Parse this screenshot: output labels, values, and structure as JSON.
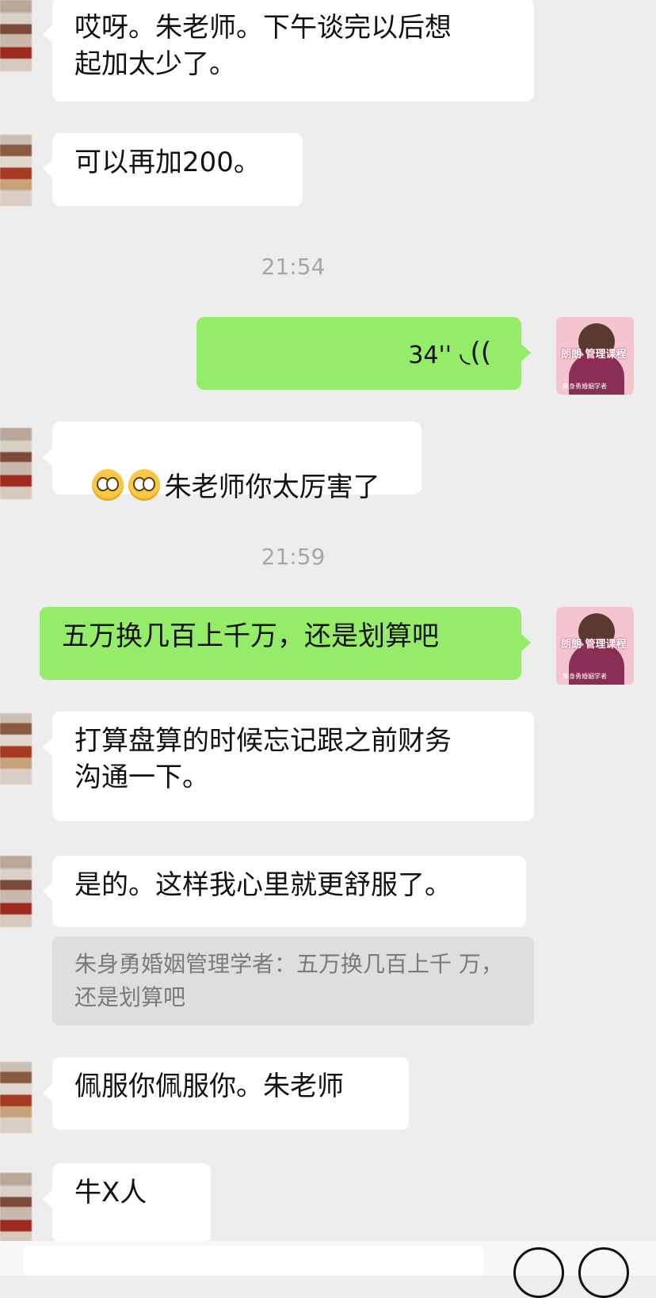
{
  "messages": {
    "m1": "哎呀。朱老师。下午谈完以后想\n起加太少了。",
    "m2": "可以再加200。",
    "t1": "21:54",
    "voice_length": "34''",
    "voice_icon": "voice-wave-icon",
    "m3": "朱老师你太厉害了",
    "t2": "21:59",
    "m4": "五万换几百上千万，还是划算吧",
    "m5": "打算盘算的时候忘记跟之前财务\n沟通一下。",
    "m6": "是的。这样我心里就更舒服了。",
    "quote": "朱身勇婚姻管理学者：五万换几百上千\n万，还是划算吧",
    "m7": "佩服你佩服你。朱老师",
    "m8": "牛X人"
  },
  "avatar_right": {
    "title": "朗朗\n管理课程",
    "subtitle": "朱身勇婚姻学者"
  },
  "colors": {
    "background": "#ededed",
    "bubble_white": "#ffffff",
    "bubble_green": "#95ec69",
    "timestamp": "#a6a6a6"
  }
}
